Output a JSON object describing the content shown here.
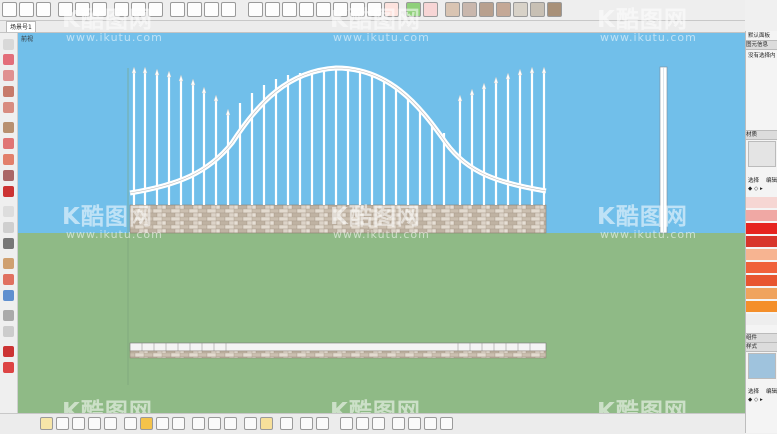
{
  "scene_tab": "场景号1",
  "view_label": "前视",
  "watermark": {
    "logo_text": "K酷图网",
    "url": "www.ikutu.com"
  },
  "right_panel": {
    "tray_label": "默认面板",
    "entity_info_label": "图元信息",
    "no_selection": "没有选择内",
    "materials_label": "材质",
    "select_tab": "选择",
    "edit_tab": "编辑",
    "components_label": "组件",
    "styles_label": "样式",
    "select_tab_2": "选择",
    "edit_tab_2": "编辑"
  },
  "colors": {
    "sky": "#71bfea",
    "ground": "#8fba86",
    "swatches": [
      "#f6d6d3",
      "#f0a8a4",
      "#e62420",
      "#d8352b",
      "#f7b491",
      "#f0613b",
      "#e8552f",
      "#f0a35d",
      "#f48f2a"
    ]
  },
  "icons": {
    "top_toolbar": [
      "select-icon",
      "paint-bucket-icon",
      "move-icon",
      "new-file-icon",
      "open-icon",
      "save-icon",
      "print-icon",
      "camera-icon",
      "box-icon",
      "cone-icon",
      "brush-icon",
      "pattern-icon",
      "gem-icon",
      "sun-shadow-icon",
      "palette-icon",
      "texture-icon"
    ],
    "left_toolbar": [
      "select-icon",
      "eraser-icon",
      "rectangle-icon",
      "circle-icon",
      "arc-icon",
      "polygon-icon",
      "pushpull-icon",
      "rotate-icon",
      "scale-icon",
      "offset-icon",
      "tape-icon",
      "text-icon",
      "protractor-icon",
      "axes-icon",
      "orbit-icon",
      "pan-icon",
      "zoom-icon",
      "walk-icon"
    ],
    "bottom_toolbar": [
      "ruby-icon",
      "sandbox-icon",
      "layers-icon",
      "sound-icon",
      "camera-icon",
      "section-icon",
      "outliner-icon",
      "video-icon",
      "globe-icon"
    ]
  }
}
